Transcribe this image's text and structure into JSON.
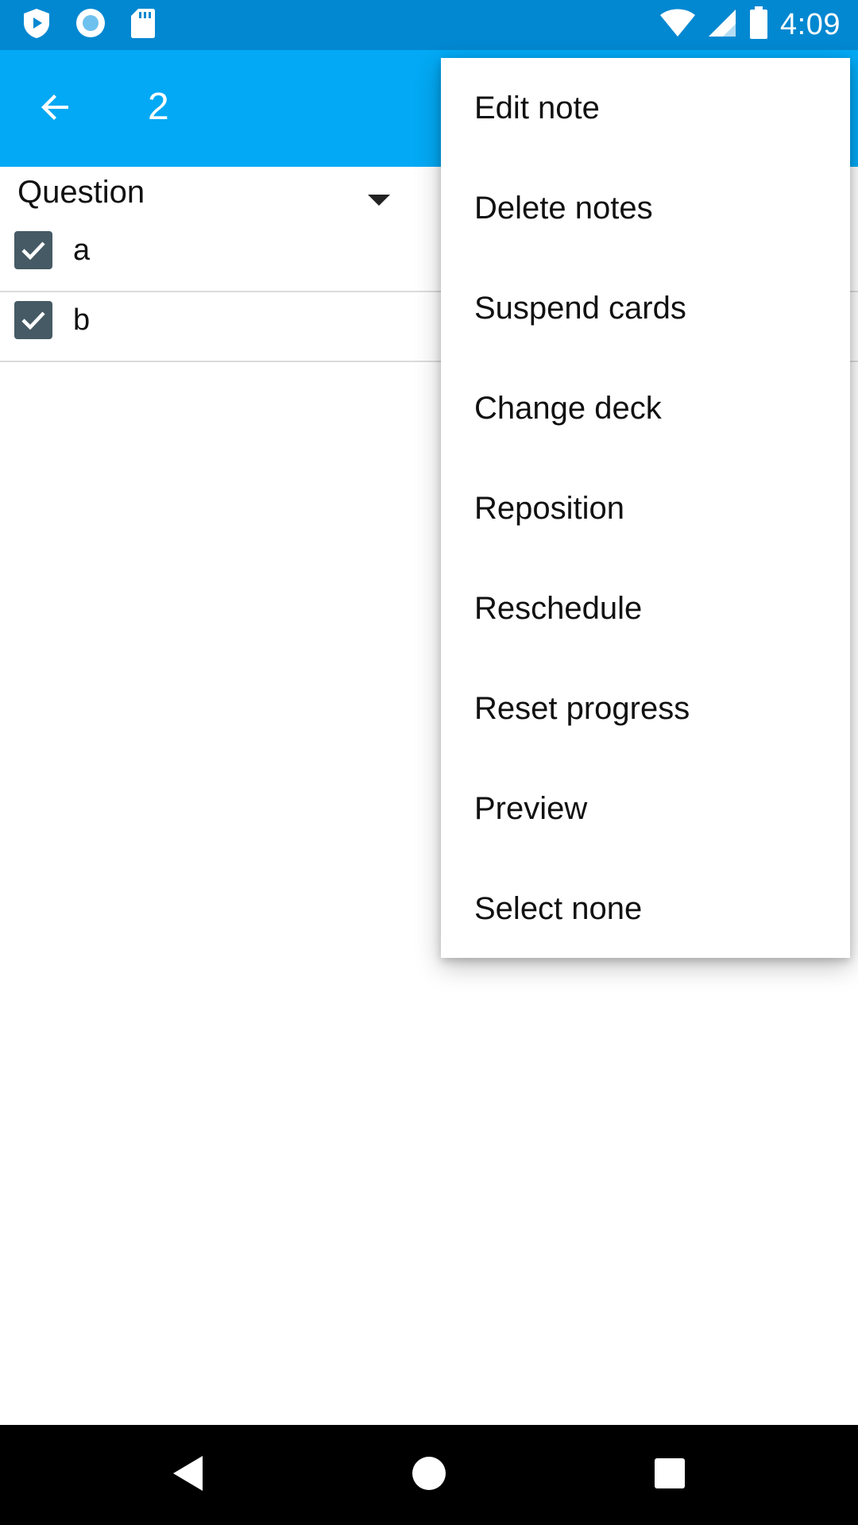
{
  "status_bar": {
    "time": "4:09",
    "left_icons": [
      "play-shield-icon",
      "record-circle-icon",
      "sd-card-icon"
    ],
    "right_icons": [
      "wifi-icon",
      "signal-icon",
      "battery-icon"
    ]
  },
  "app_bar": {
    "back_icon": "arrow-back-icon",
    "title": "2",
    "color": "#03a9f4"
  },
  "column_header": {
    "label": "Question"
  },
  "cards": [
    {
      "text": "a",
      "checked": true
    },
    {
      "text": "b",
      "checked": true
    }
  ],
  "menu": {
    "items": [
      "Edit note",
      "Delete notes",
      "Suspend cards",
      "Change deck",
      "Reposition",
      "Reschedule",
      "Reset progress",
      "Preview",
      "Select none"
    ]
  },
  "nav_bar": {
    "buttons": [
      "back-triangle-icon",
      "home-circle-icon",
      "recents-square-icon"
    ]
  }
}
